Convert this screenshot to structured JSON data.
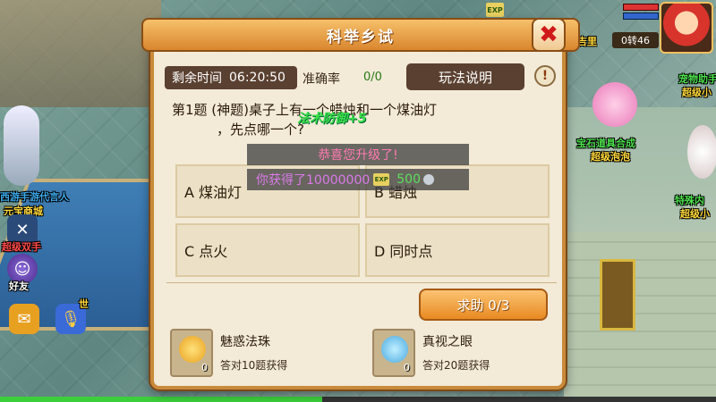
{
  "dialog": {
    "title": "科举乡试",
    "close_glyph": "✖",
    "time_label": "剩余时间",
    "time_value": "06:20:50",
    "accuracy_label": "准确率",
    "accuracy_value": "0/0",
    "rules_button": "玩法说明",
    "info_glyph": "!",
    "question_line1": "第1题 (神题)桌子上有一个蜡烛和一个煤油灯",
    "question_line2": "，先点哪一个?",
    "options": [
      {
        "label": "A 煤油灯"
      },
      {
        "label": "B 蜡烛"
      },
      {
        "label": "C 点火"
      },
      {
        "label": "D 同时点"
      }
    ],
    "help_button": "求助 0/3",
    "items": [
      {
        "name": "魅惑法珠",
        "count": "0",
        "hint": "答对10题获得"
      },
      {
        "name": "真视之眼",
        "count": "0",
        "hint": "答对20题获得"
      }
    ]
  },
  "floating": {
    "buff": "法术防御+5",
    "level_up": "恭喜您升级了!",
    "gain_prefix": "你获得了10000000",
    "exp_badge": "EXP",
    "gain_amount": "500"
  },
  "hud": {
    "exp_icon": "EXP",
    "level": "0转46",
    "map_label_top": "吉里",
    "left_labels": [
      "西游手游代言人",
      "元宝商城",
      "超级双手",
      "好友"
    ],
    "right_labels": [
      "宠物助手",
      "超级小",
      "宝石道具合成",
      "超级泡泡",
      "特殊内",
      "超级小"
    ],
    "voice_badge": "世",
    "exp_progress": 0.45
  },
  "colors": {
    "panel_bg": "#f3ead7",
    "panel_border": "#c98a3a",
    "title_bar": "#e39a3e",
    "accuracy_green": "#2a7a1a",
    "help_orange": "#e88a22"
  }
}
